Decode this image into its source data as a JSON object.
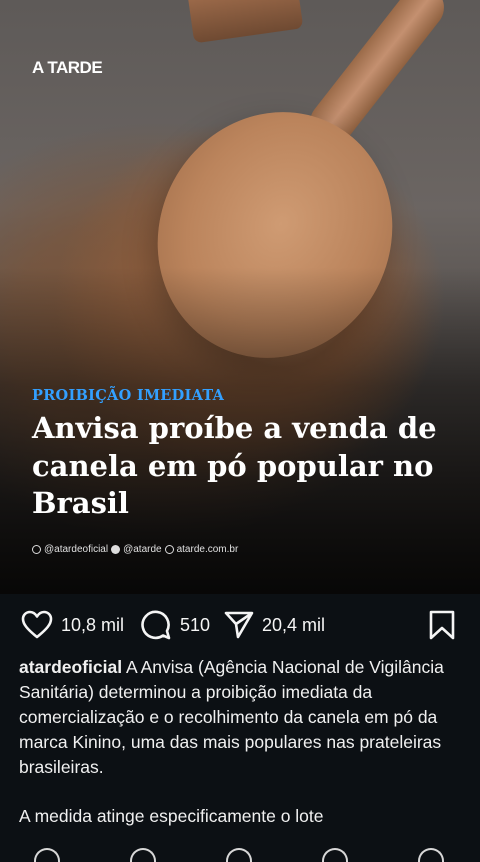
{
  "post": {
    "brand": "A TARDE",
    "kicker": "PROIBIÇÃO IMEDIATA",
    "headline": "Anvisa proíbe a venda de canela em pó popular no Brasil",
    "handles": {
      "instagram": "@atardeoficial",
      "facebook": "@atarde",
      "site": "atarde.com.br"
    }
  },
  "actions": {
    "likes": "10,8 mil",
    "comments": "510",
    "shares": "20,4 mil"
  },
  "caption": {
    "username": "atardeoficial",
    "text": "A Anvisa (Agência Nacional de Vigilância Sanitária) determinou a proibição imediata da comercialização e o recolhimento da canela em pó da marca Kinino, uma das mais populares nas prateleiras brasileiras.",
    "text2": "A medida atinge especificamente o lote"
  },
  "icons": [
    "heart-icon",
    "comment-icon",
    "share-icon",
    "bookmark-icon",
    "instagram-icon",
    "facebook-icon",
    "globe-icon"
  ],
  "colors": {
    "kicker": "#33a0ff",
    "background": "#0c1014"
  }
}
